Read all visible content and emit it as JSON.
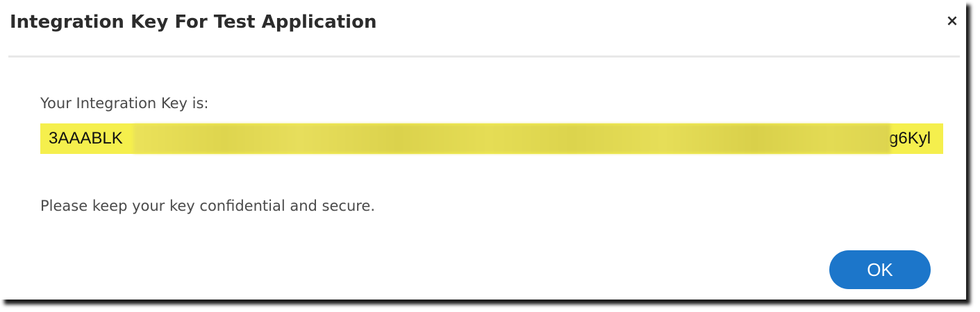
{
  "dialog": {
    "title": "Integration Key For Test Application",
    "close_label": "×",
    "key_label": "Your Integration Key is:",
    "key_visible_start": "3AAABLK",
    "key_visible_end": "g6Kyl",
    "notice": "Please keep your key confidential and secure.",
    "ok_label": "OK"
  },
  "colors": {
    "key_highlight": "#f5ef4d",
    "ok_button": "#1c76ca",
    "title_text": "#2c2c2c"
  },
  "icons": {
    "close": "close-icon"
  }
}
